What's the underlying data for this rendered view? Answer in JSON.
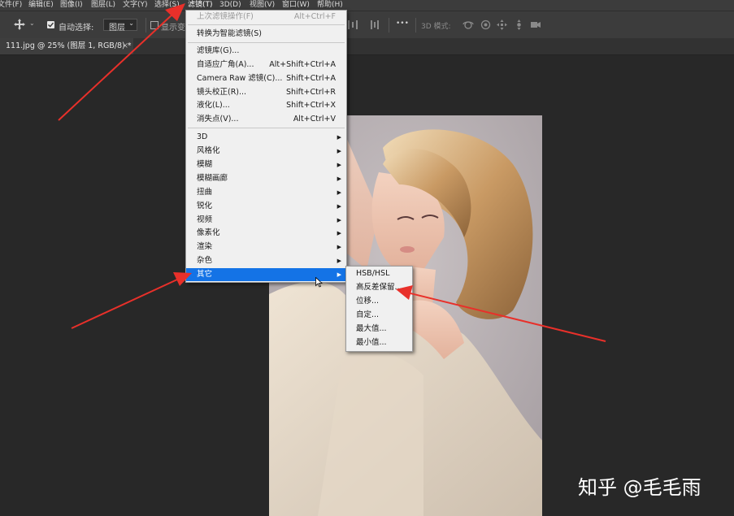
{
  "menubar": {
    "items": [
      {
        "label": "文件(F)"
      },
      {
        "label": "编辑(E)"
      },
      {
        "label": "图像(I)"
      },
      {
        "label": "图层(L)"
      },
      {
        "label": "文字(Y)"
      },
      {
        "label": "选择(S)"
      },
      {
        "label": "滤镜(T)"
      },
      {
        "label": "3D(D)"
      },
      {
        "label": "视图(V)"
      },
      {
        "label": "窗口(W)"
      },
      {
        "label": "帮助(H)"
      }
    ]
  },
  "options_bar": {
    "auto_select_label": "自动选择:",
    "layer_select_value": "图层",
    "show_transform_label": "显示变",
    "more_label": "•••",
    "mode_3d_label": "3D 模式:"
  },
  "document_tab": {
    "title": "111.jpg @ 25% (图层 1, RGB/8) *",
    "close": "×"
  },
  "filter_menu": {
    "items": [
      {
        "label": "上次滤镜操作(F)",
        "shortcut": "Alt+Ctrl+F",
        "disabled": true
      },
      {
        "label": "转换为智能滤镜(S)",
        "shortcut": ""
      },
      {
        "label": "滤镜库(G)...",
        "shortcut": ""
      },
      {
        "label": "自适应广角(A)...",
        "shortcut": "Alt+Shift+Ctrl+A"
      },
      {
        "label": "Camera Raw 滤镜(C)...",
        "shortcut": "Shift+Ctrl+A"
      },
      {
        "label": "镜头校正(R)...",
        "shortcut": "Shift+Ctrl+R"
      },
      {
        "label": "液化(L)...",
        "shortcut": "Shift+Ctrl+X"
      },
      {
        "label": "消失点(V)...",
        "shortcut": "Alt+Ctrl+V"
      },
      {
        "label": "3D"
      },
      {
        "label": "风格化"
      },
      {
        "label": "模糊"
      },
      {
        "label": "模糊画廊"
      },
      {
        "label": "扭曲"
      },
      {
        "label": "锐化"
      },
      {
        "label": "视频"
      },
      {
        "label": "像素化"
      },
      {
        "label": "渲染"
      },
      {
        "label": "杂色"
      },
      {
        "label": "其它",
        "highlighted": true
      }
    ]
  },
  "other_submenu": {
    "items": [
      {
        "label": "HSB/HSL"
      },
      {
        "label": "高反差保留..."
      },
      {
        "label": "位移..."
      },
      {
        "label": "自定..."
      },
      {
        "label": "最大值..."
      },
      {
        "label": "最小值..."
      }
    ]
  },
  "watermark": "知乎 @毛毛雨",
  "colors": {
    "menu_bg": "#f0f0f0",
    "highlight": "#1473e6",
    "arrow": "#e8302a",
    "workspace": "#282828"
  }
}
